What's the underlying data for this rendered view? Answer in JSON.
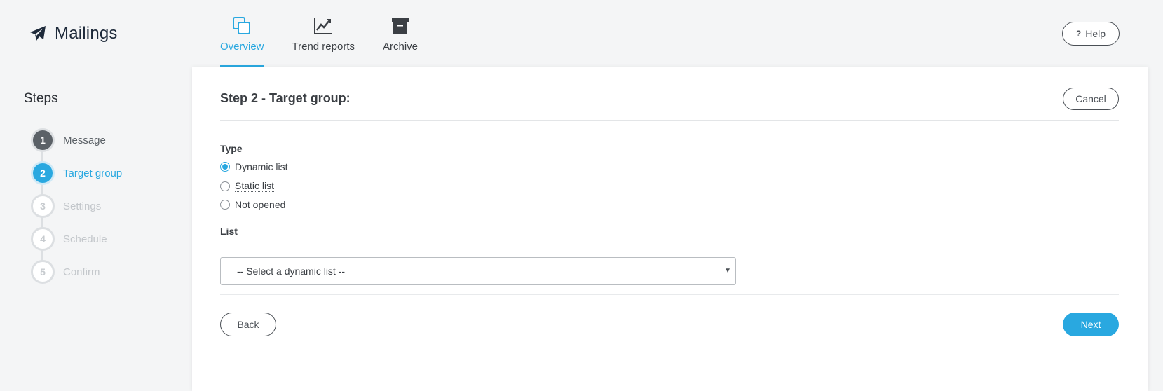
{
  "app": {
    "title": "Mailings",
    "icon": "paper-plane-icon"
  },
  "nav": {
    "tabs": [
      {
        "label": "Overview",
        "icon": "overview-icon",
        "active": true
      },
      {
        "label": "Trend reports",
        "icon": "trend-chart-icon",
        "active": false
      },
      {
        "label": "Archive",
        "icon": "archive-box-icon",
        "active": false
      }
    ]
  },
  "help": {
    "label": "Help",
    "icon": "?"
  },
  "sidebar": {
    "title": "Steps",
    "steps": [
      {
        "num": "1",
        "label": "Message",
        "state": "done"
      },
      {
        "num": "2",
        "label": "Target group",
        "state": "current"
      },
      {
        "num": "3",
        "label": "Settings",
        "state": "pending"
      },
      {
        "num": "4",
        "label": "Schedule",
        "state": "pending"
      },
      {
        "num": "5",
        "label": "Confirm",
        "state": "pending"
      }
    ]
  },
  "main": {
    "title": "Step 2 - Target group:",
    "cancel_label": "Cancel",
    "type_label": "Type",
    "type_options": [
      {
        "label": "Dynamic list",
        "checked": true
      },
      {
        "label": "Static list",
        "checked": false
      },
      {
        "label": "Not opened",
        "checked": false
      }
    ],
    "list_label": "List",
    "list_select": {
      "selected": "-- Select a dynamic list --"
    },
    "back_label": "Back",
    "next_label": "Next"
  },
  "colors": {
    "accent": "#29a8e0",
    "dark": "#3b3f44",
    "muted": "#c3c7cb"
  }
}
